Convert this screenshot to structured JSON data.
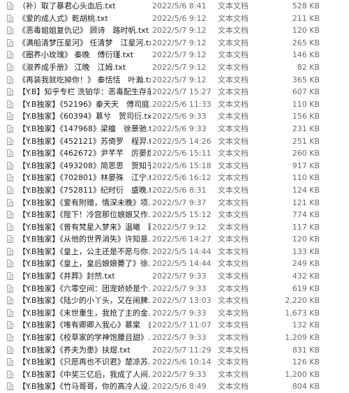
{
  "files": [
    {
      "name": "（补）取了暴君心头血后.txt",
      "date": "2022/5/6 8:41",
      "type": "文本文档",
      "size": "528 KB"
    },
    {
      "name": "《爱的成人式》乾胡桃.txt",
      "date": "2022/5/6 9:12",
      "type": "文本文档",
      "size": "211 KB"
    },
    {
      "name": "《恶毒姐姐复仇记》 顾诗　路时帆.txt",
      "date": "2022/5/7 9:12",
      "type": "文本文档",
      "size": "120 KB"
    },
    {
      "name": "《满船清梦压星河》 任清梦　江星河.txt",
      "date": "2022/5/7 9:12",
      "type": "文本文档",
      "size": "265 KB"
    },
    {
      "name": "《圈养小玫瑰》 秦晚　傅衍瑾.txt",
      "date": "2022/5/7 9:12",
      "type": "文本文档",
      "size": "146 KB"
    },
    {
      "name": "《淑养成手册》 江晚　江姆.txt",
      "date": "2022/5/7 9:12",
      "type": "文本文档",
      "size": "82 KB"
    },
    {
      "name": "《再装我就吃掉你！》 秦恬恬　叶瀚.txt",
      "date": "2022/5/7 9:12",
      "type": "文本文档",
      "size": "365 KB"
    },
    {
      "name": "【Y.B】知乎专栏 洗铂华：恶毒配生存录.txt",
      "date": "2022/5/7 15:27",
      "type": "文本文档",
      "size": "607 KB"
    },
    {
      "name": "【Y.B独家】《52196》秦天天　傅司庭.txt",
      "date": "2022/5/6 11:33",
      "type": "文本文档",
      "size": "110 KB"
    },
    {
      "name": "【Y.B独家】《60394》慕兮　贺司衍.txt",
      "date": "2022/5/6 9:33",
      "type": "文本文档",
      "size": "156 KB"
    },
    {
      "name": "【Y.B独家】《147968》梁檀　徐景驰.txt",
      "date": "2022/5/6 9:33",
      "type": "文本文档",
      "size": "231 KB"
    },
    {
      "name": "【Y.B独家】《452121》苏倚罗　程羿.txt",
      "date": "2022/5/5 14:26",
      "type": "文本文档",
      "size": "251 KB"
    },
    {
      "name": "【Y.B独家】《462672》尹芊芊　厉晏煜.txt",
      "date": "2022/5/6 15:11",
      "type": "文本文档",
      "size": "260 KB"
    },
    {
      "name": "【Y.B独家】《493208》简思思　贺知予.txt",
      "date": "2022/5/6 15:18",
      "type": "文本文档",
      "size": "917 KB"
    },
    {
      "name": "【Y.B独家】《702801》林晏殊　江宁.txt",
      "date": "2022/5/6 16:12",
      "type": "文本文档",
      "size": "110 KB"
    },
    {
      "name": "【Y.B独家】《752811》纪时衍　盛晚.txt",
      "date": "2022/5/6 8:31",
      "type": "文本文档",
      "size": "124 KB"
    },
    {
      "name": "【Y.B独家】《爱有附赠，情深未晚》项...",
      "date": "2022/5/7 9:37",
      "type": "文本文档",
      "size": "121 KB"
    },
    {
      "name": "【Y.B独家】《陛下！冷宫那位娘娘又作...",
      "date": "2022/5/5 15:12",
      "type": "文本文档",
      "size": "774 KB"
    },
    {
      "name": "【Y.B独家】《曾有梵星入梦来》温曦　顾...",
      "date": "2022/5/7 9:12",
      "type": "文本文档",
      "size": "117 KB"
    },
    {
      "name": "【Y.B独家】《从他的世界消失》许知意...",
      "date": "2022/5/6 14:27",
      "type": "文本文档",
      "size": "120 KB"
    },
    {
      "name": "【Y.B独家】《皇上，公主还是不愿与你...",
      "date": "2022/5/5 14:44",
      "type": "文本文档",
      "size": "133 KB"
    },
    {
      "name": "【Y.B独家】《皇上，皇后娘娘薨了》徐...",
      "date": "2022/5/5 14:44",
      "type": "文本文档",
      "size": "249 KB"
    },
    {
      "name": "【Y.B独家】《井葬》封然.txt",
      "date": "2022/5/7 9:33",
      "type": "文本文档",
      "size": "432 KB"
    },
    {
      "name": "【Y.B独家】《六零空间：团宠娇娇是个...",
      "date": "2022/5/7 9:33",
      "type": "文本文档",
      "size": "619 KB"
    },
    {
      "name": "【Y.B独家】《陆少的小丫头，又在闹脾...",
      "date": "2022/5/7 13:03",
      "type": "文本文档",
      "size": "2,220 KB"
    },
    {
      "name": "【Y.B独家】《末世重生，我抢了主的金...",
      "date": "2022/5/7 9:33",
      "type": "文本文档",
      "size": "1,673 KB"
    },
    {
      "name": "【Y.B独家】《唯有卿卿入我心》慕棠　杏...",
      "date": "2022/5/7 11:07",
      "type": "文本文档",
      "size": "132 KB"
    },
    {
      "name": "【Y.B独家】《校草家的学神饱腰且甜》...",
      "date": "2022/5/7 9:33",
      "type": "文本文档",
      "size": "1,209 KB"
    },
    {
      "name": "【Y.B独家】《养夫为患》扶煜.txt",
      "date": "2022/5/7 11:29",
      "type": "文本文档",
      "size": "831 KB"
    },
    {
      "name": "【Y.B独家】《只愿再也不识君》楚凉苏...",
      "date": "2022/5/6 10:14",
      "type": "文本文档",
      "size": "126 KB"
    },
    {
      "name": "【Y.B独家】《中奖三亿后，我成了人间...",
      "date": "2022/5/7 9:33",
      "type": "文本文档",
      "size": "1,200 KB"
    },
    {
      "name": "【Y.B独家】《竹马哥哥，你的高冷人设...",
      "date": "2022/5/6 8:49",
      "type": "文本文档",
      "size": "804 KB"
    }
  ]
}
